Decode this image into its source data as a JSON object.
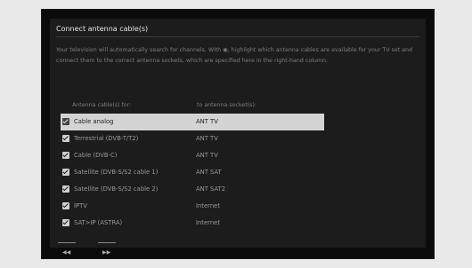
{
  "dialog": {
    "title": "Connect antenna cable(s)",
    "intro": "Your television will automatically search for channels. With ◉, highlight which antenna cables are available for your TV set and connect them to the correct antenna sockets, which are specified here in the right-hand column."
  },
  "table": {
    "col_cable": "Antenna cable(s) for:",
    "col_socket": "to antenna socket(s):",
    "rows": [
      {
        "cable": "Cable analog",
        "socket": "ANT TV",
        "checked": true,
        "selected": true
      },
      {
        "cable": "Terrestrial (DVB-T/T2)",
        "socket": "ANT TV",
        "checked": true,
        "selected": false
      },
      {
        "cable": "Cable (DVB-C)",
        "socket": "ANT TV",
        "checked": true,
        "selected": false
      },
      {
        "cable": "Satellite (DVB-S/S2 cable 1)",
        "socket": "ANT SAT",
        "checked": true,
        "selected": false
      },
      {
        "cable": "Satellite (DVB-S/S2 cable 2)",
        "socket": "ANT SAT2",
        "checked": true,
        "selected": false
      },
      {
        "cable": "IPTV",
        "socket": "Internet",
        "checked": true,
        "selected": false
      },
      {
        "cable": "SAT>IP (ASTRA)",
        "socket": "Internet",
        "checked": true,
        "selected": false
      }
    ]
  },
  "nav": {
    "back_label": "◀◀",
    "next_label": "▶▶"
  }
}
